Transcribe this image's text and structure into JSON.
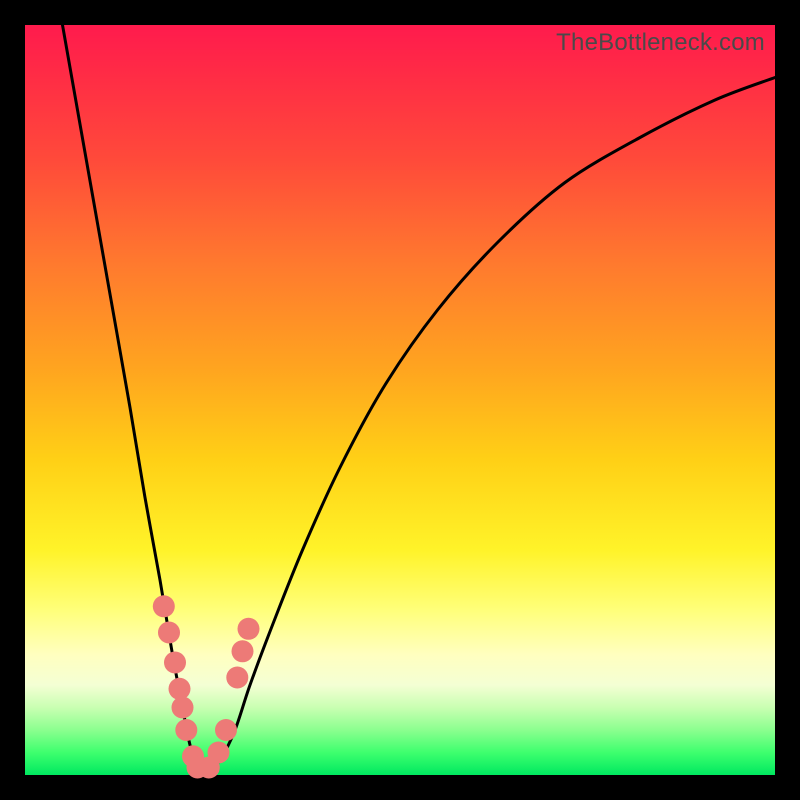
{
  "watermark": "TheBottleneck.com",
  "colors": {
    "frame": "#000000",
    "curve": "#000000",
    "marker": "#ed7a77"
  },
  "chart_data": {
    "type": "line",
    "title": "",
    "xlabel": "",
    "ylabel": "",
    "xlim": [
      0,
      100
    ],
    "ylim": [
      0,
      100
    ],
    "curve": {
      "name": "bottleneck-curve",
      "x": [
        5,
        8,
        11,
        14,
        16,
        18,
        19.5,
        21,
        22,
        23,
        24,
        26,
        28,
        30,
        33,
        37,
        42,
        48,
        55,
        63,
        72,
        82,
        92,
        100
      ],
      "y": [
        100,
        83,
        66,
        49,
        37,
        26,
        17,
        9,
        4,
        1,
        0,
        2,
        6,
        12,
        20,
        30,
        41,
        52,
        62,
        71,
        79,
        85,
        90,
        93
      ]
    },
    "markers": {
      "name": "highlight-points",
      "x": [
        18.5,
        19.2,
        20.0,
        20.6,
        21.0,
        21.5,
        22.4,
        23.0,
        24.5,
        25.8,
        26.8,
        28.3,
        29.0,
        29.8
      ],
      "y": [
        22.5,
        19.0,
        15.0,
        11.5,
        9.0,
        6.0,
        2.5,
        1.0,
        1.0,
        3.0,
        6.0,
        13.0,
        16.5,
        19.5
      ]
    }
  }
}
